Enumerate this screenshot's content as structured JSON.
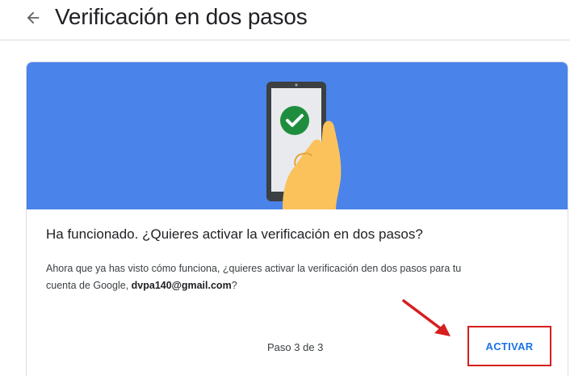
{
  "header": {
    "back_icon": "arrow-left-icon",
    "title": "Verificación en dos pasos"
  },
  "card": {
    "banner_color": "#4a83ea",
    "illustration_icon": "phone-check-icon",
    "heading": "Ha funcionado. ¿Quieres activar la verificación en dos pasos?",
    "description_line1": "Ahora que ya has visto cómo funciona, ¿quieres activar la verificación den dos pasos para tu",
    "description_prefix": "cuenta de Google, ",
    "email": "dvpa140@gmail.com",
    "description_suffix": "?",
    "step_label": "Paso 3 de 3",
    "activate_label": "ACTIVAR"
  },
  "annotation": {
    "arrow_icon": "red-arrow-icon",
    "highlight_color": "#d71e1e"
  }
}
